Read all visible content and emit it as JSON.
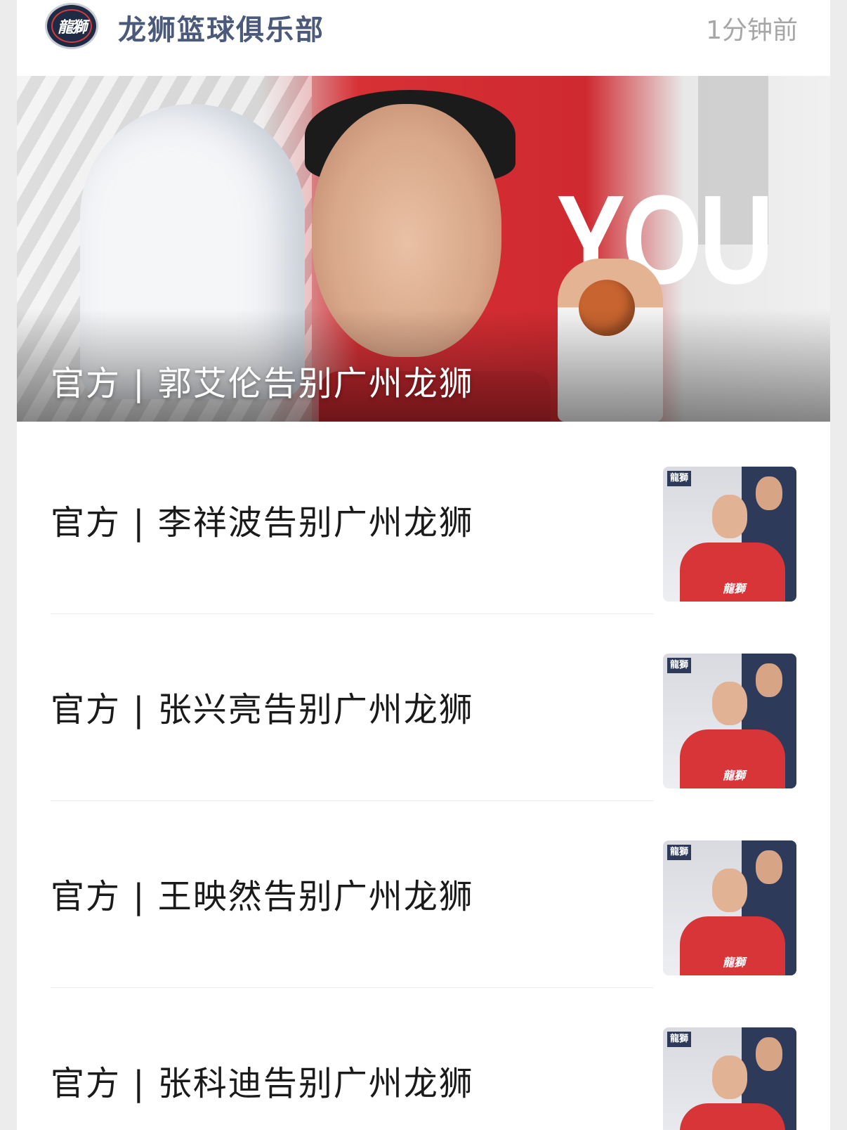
{
  "header": {
    "account_name": "龙狮篮球俱乐部",
    "time": "1分钟前"
  },
  "banner": {
    "title": "官方 | 郭艾伦告别广州龙狮",
    "big_text": "YOU"
  },
  "articles": [
    {
      "title": "官方 | 李祥波告别广州龙狮"
    },
    {
      "title": "官方 | 张兴亮告别广州龙狮"
    },
    {
      "title": "官方 | 王映然告别广州龙狮"
    },
    {
      "title": "官方 | 张科迪告别广州龙狮"
    }
  ],
  "colors": {
    "account_name": "#4b5a7a",
    "brand_red": "#d73035",
    "brand_navy": "#2d3a5a"
  }
}
